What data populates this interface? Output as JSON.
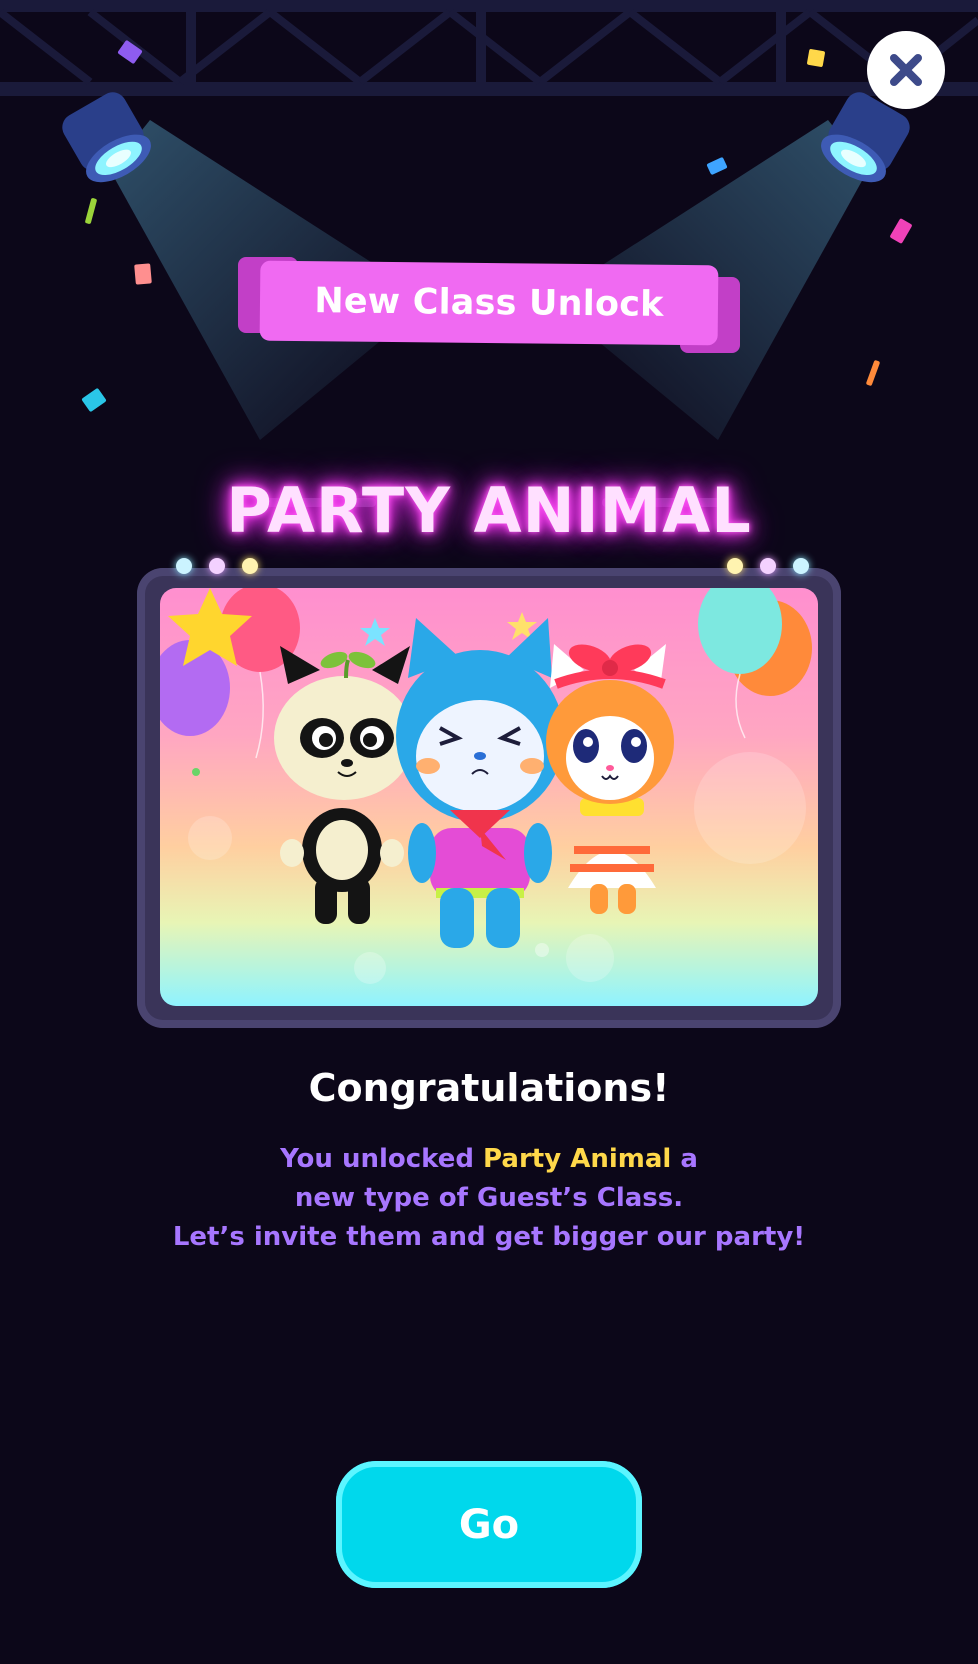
{
  "header": {
    "banner_label": "New Class Unlock",
    "close_icon": "close-icon"
  },
  "unlock": {
    "class_name": "PARTY ANIMAL",
    "image_description_icon": "party-animal-characters"
  },
  "message": {
    "title": "Congratulations!",
    "line1_prefix": "You unlocked ",
    "line1_highlight": "Party Animal",
    "line1_suffix": " a",
    "line2": "new type of Guest’s Class.",
    "line3": "Let’s invite them and get bigger our party!"
  },
  "actions": {
    "go_label": "Go"
  },
  "colors": {
    "background": "#0c0719",
    "banner": "#f06af2",
    "neon": "#ff3cf2",
    "description": "#a776ff",
    "highlight": "#ffd84a",
    "go_button": "#00d8ec",
    "close_x": "#3d4a8a"
  }
}
